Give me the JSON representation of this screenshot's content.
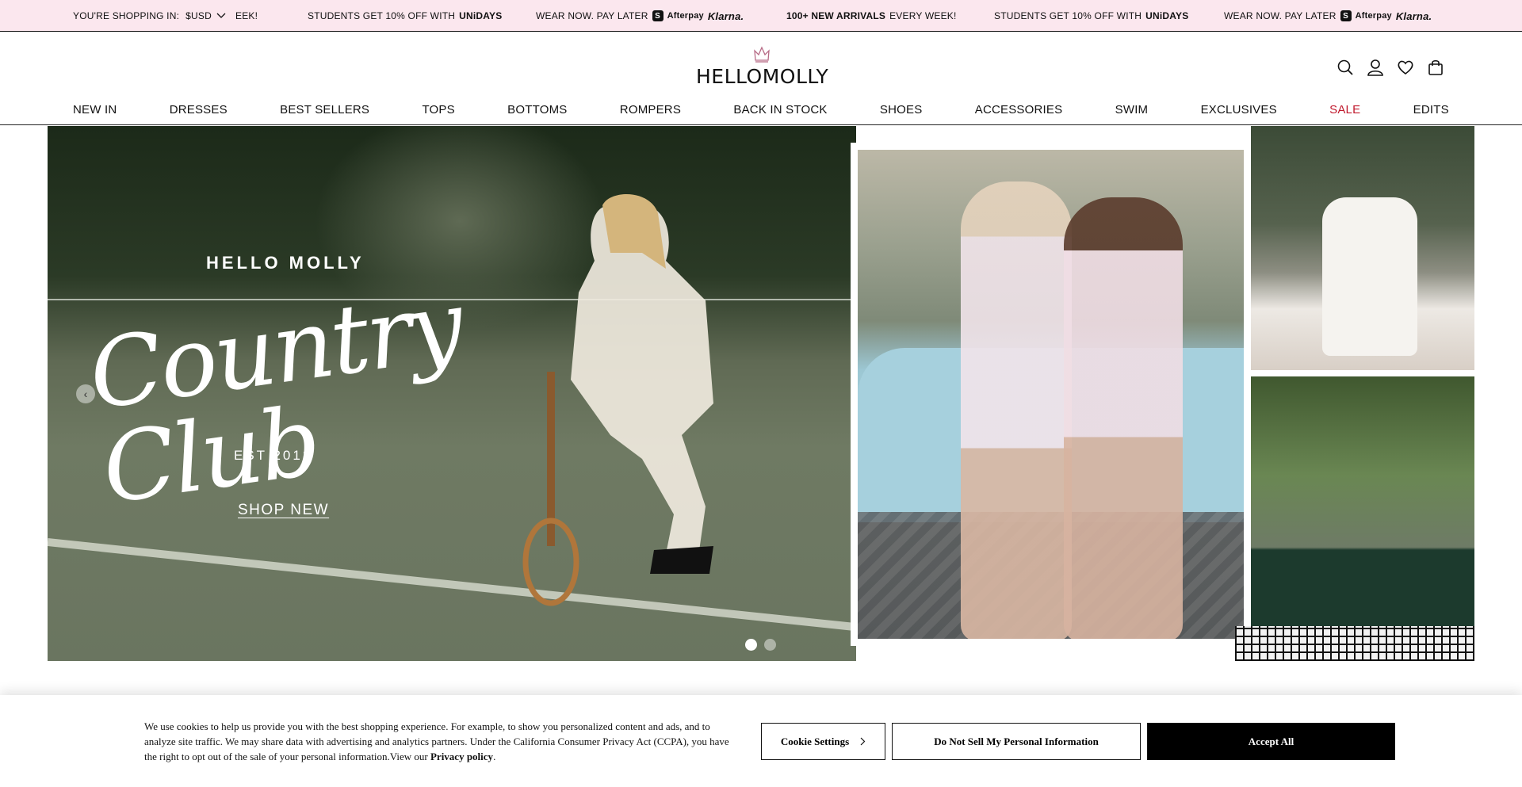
{
  "topbar": {
    "currency_label": "YOU'RE SHOPPING IN:",
    "currency_value": "$USD",
    "partial_msg": "EEK!",
    "msg1_prefix": "STUDENTS GET 10% OFF WITH",
    "msg1_brand": "UNiDAYS",
    "msg2_prefix": "WEAR NOW. PAY LATER",
    "msg2_afterpay": "Afterpay",
    "msg2_klarna": "Klarna.",
    "msg3_bold": "100+ NEW ARRIVALS",
    "msg3_rest": "EVERY WEEK!",
    "msg4_prefix": "STUDENTS GET 10% OFF WITH",
    "msg4_brand": "UNiDAYS",
    "msg5_prefix": "WEAR NOW. PAY LATER",
    "msg5_afterpay": "Afterpay",
    "msg5_klarna": "Klarna."
  },
  "header": {
    "logo": "HELLOMOLLY"
  },
  "nav": {
    "items": [
      "NEW IN",
      "DRESSES",
      "BEST SELLERS",
      "TOPS",
      "BOTTOMS",
      "ROMPERS",
      "BACK IN STOCK",
      "SHOES",
      "ACCESSORIES",
      "SWIM",
      "EXCLUSIVES",
      "SALE",
      "EDITS"
    ]
  },
  "hero": {
    "brand": "HELLO MOLLY",
    "script": "Country Club",
    "est": "EST 2012",
    "cta": "SHOP NEW",
    "prev": "‹"
  },
  "cookie": {
    "text": "We use cookies to help us provide you with the best shopping experience. For example, to show you personalized content and ads, and to analyze site traffic. We may share data with advertising and analytics partners. Under the California Consumer Privacy Act (CCPA), you have the right to opt out of the sale of your personal information.View our ",
    "privacy_link": "Privacy policy",
    "privacy_suffix": ".",
    "settings_label": "Cookie Settings",
    "dns_label": "Do Not Sell My Personal Information",
    "accept_label": "Accept All"
  },
  "colors": {
    "topbar_bg": "#fbe7ee",
    "sale": "#c0182c",
    "accept_bg": "#000000"
  }
}
